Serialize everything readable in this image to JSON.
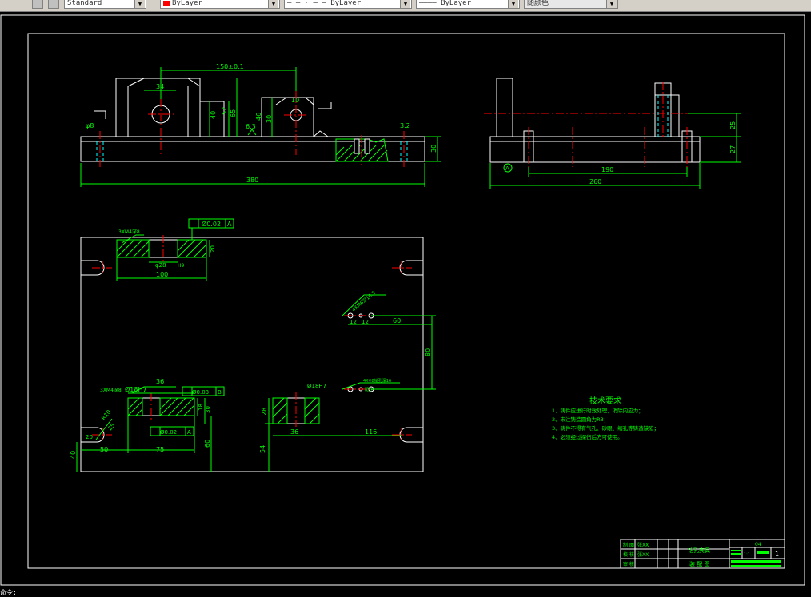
{
  "toolbar": {
    "text_style": "Standard",
    "layer_color": "ByLayer",
    "linetype": "ByLayer",
    "lineweight": "ByLayer",
    "plot_color": "随颜色"
  },
  "colors": {
    "green": "#00ff00",
    "red": "#ff0000",
    "white": "#ffffff",
    "yellow": "#ffff00",
    "cyan": "#00ffff",
    "magenta": "#ff00ff"
  },
  "front_view": {
    "dim_width": "150±0.1",
    "dim_34": "34",
    "dim_40": "40",
    "dim_52": "52",
    "dim_65": "65",
    "dim_46": "46",
    "dim_30h": "30",
    "dim_10": "10",
    "dim_63": "6.3",
    "dim_30": "30",
    "dim_total": "380",
    "dim_left_small": "φ8",
    "dim_right_small": "3.2"
  },
  "side_view": {
    "dim_25": "25",
    "dim_27": "27",
    "dim_190": "190",
    "dim_260": "260",
    "datum": "A"
  },
  "top_view": {
    "note_top": "3XM4深8",
    "tol_top": "Ø0.02",
    "tol_top_ref": "A",
    "dim_28": "φ28",
    "dim_h9": "H9",
    "dim_20": "20",
    "dim_100": "100",
    "note_holes": "4XM6深10.5",
    "dim_12a": "12",
    "dim_12b": "12",
    "dim_60": "60",
    "dim_80": "80",
    "note_pins": "4XΦ8销孔深16",
    "note_pins2": "配作",
    "dim_18h7": "Ø18H7",
    "dim_28b": "28",
    "dim_36b": "36",
    "dim_116": "116",
    "dim_54": "54",
    "note_bottom": "3XM4深8",
    "dim_18hole": "Ø18H7",
    "dim_36": "36",
    "tol_pos": "Ø0.03",
    "tol_pos_ref": "B",
    "dim_18v": "18",
    "dim_30v": "30",
    "dim_r10": "R10",
    "dim_20b": "20",
    "dim_25": "25",
    "tol_bottom": "Ø0.02",
    "tol_bottom_ref": "A",
    "dim_50": "50",
    "dim_75": "75",
    "dim_40": "40",
    "dim_60b": "60"
  },
  "tech_req": {
    "title": "技术要求",
    "lines": [
      "1、铸件应进行时效处理，消除内应力；",
      "2、未注铸造圆角为R3；",
      "3、铸件不得有气孔、砂眼、缩孔等铸造缺陷；",
      "4、必须经过探伤后方可使用。"
    ]
  },
  "title_block": {
    "row1_label": "制 图",
    "row1_name": "张XX",
    "row2_label": "校 核",
    "row2_name": "张XX",
    "row3_label": "审 核",
    "part_name": "钻孔夹具",
    "drawing_type": "装 配 图",
    "drawing_no": "04",
    "scale": "1:1",
    "sheet": "1"
  },
  "status": {
    "prompt": "命令:"
  }
}
